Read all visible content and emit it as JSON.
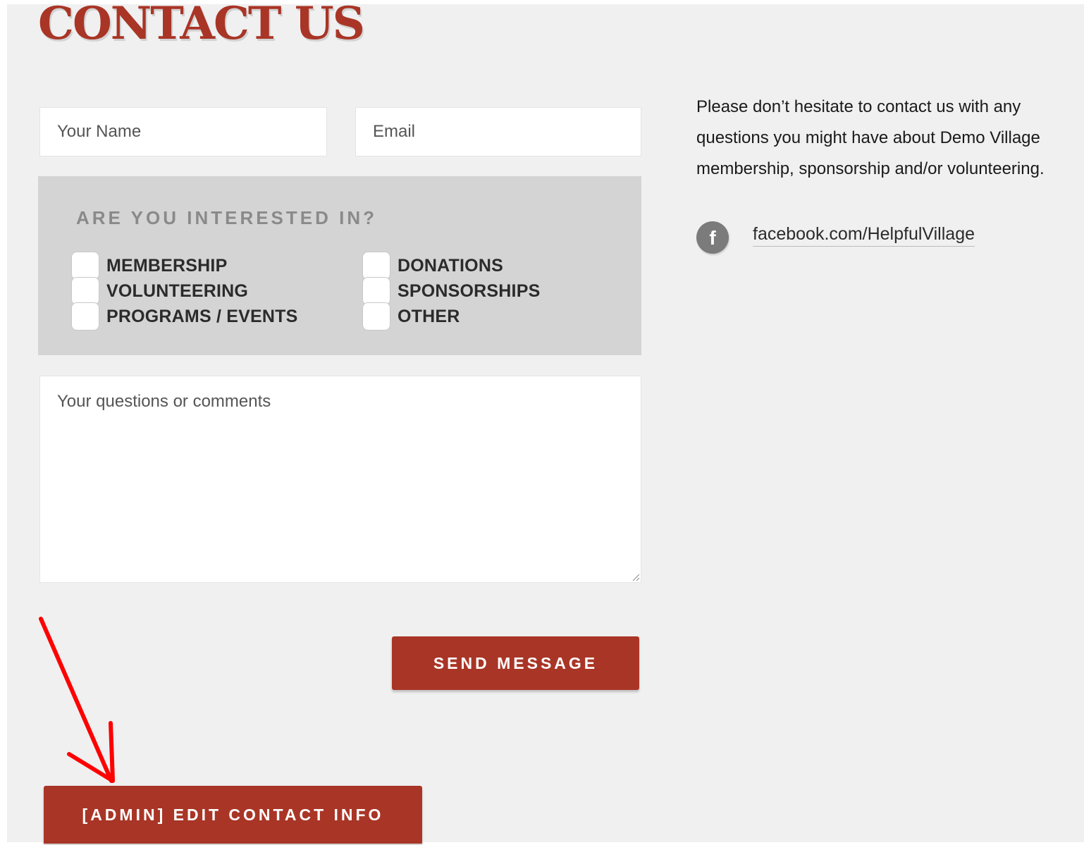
{
  "title": "CONTACT US",
  "form": {
    "name_placeholder": "Your Name",
    "email_placeholder": "Email",
    "interest_heading": "ARE YOU INTERESTED IN?",
    "interests_left": [
      "MEMBERSHIP",
      "VOLUNTEERING",
      "PROGRAMS / EVENTS"
    ],
    "interests_right": [
      "DONATIONS",
      "SPONSORSHIPS",
      "OTHER"
    ],
    "comments_placeholder": "Your questions or comments",
    "send_label": "SEND MESSAGE"
  },
  "admin": {
    "edit_label": "[ADMIN] EDIT CONTACT INFO"
  },
  "info": {
    "text": "Please don’t hesitate to contact us with any questions you might have about Demo Village membership, sponsorship and/or volunteering.",
    "facebook_icon": "f",
    "facebook_link": "facebook.com/HelpfulVillage"
  },
  "colors": {
    "brand_red": "#a93526",
    "annotation_arrow": "#ff0000",
    "page_bg": "#f0f0f0",
    "panel_bg": "#d4d4d4"
  }
}
